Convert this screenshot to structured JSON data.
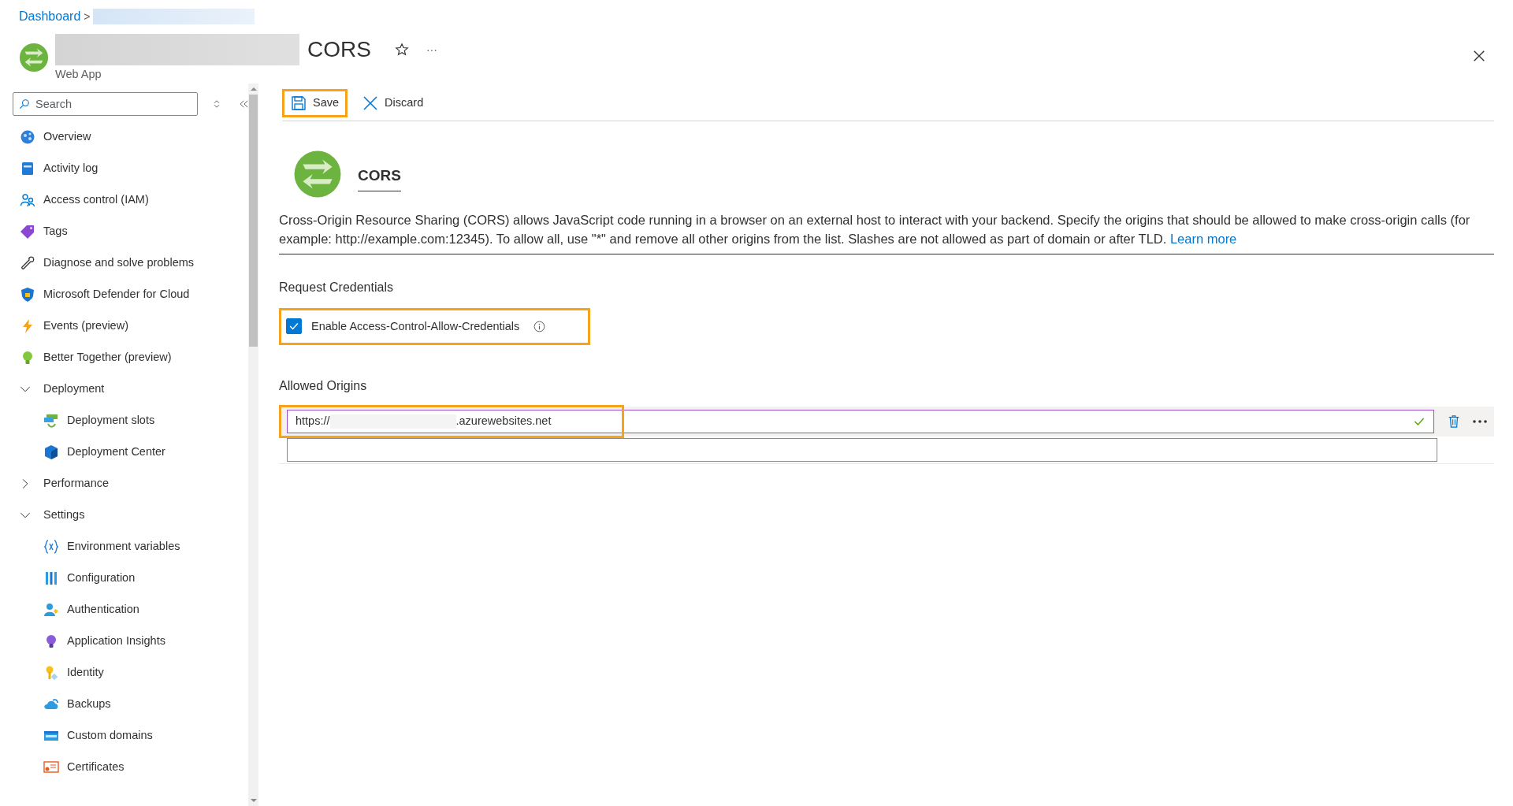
{
  "breadcrumb": {
    "items": [
      {
        "label": "Dashboard"
      }
    ],
    "separator": ">"
  },
  "header": {
    "resource_type": "Web App",
    "title": "CORS",
    "more": "···"
  },
  "sidebar": {
    "search_placeholder": "Search",
    "items": [
      {
        "kind": "item",
        "label": "Overview"
      },
      {
        "kind": "item",
        "label": "Activity log"
      },
      {
        "kind": "item",
        "label": "Access control (IAM)"
      },
      {
        "kind": "item",
        "label": "Tags"
      },
      {
        "kind": "item",
        "label": "Diagnose and solve problems"
      },
      {
        "kind": "item",
        "label": "Microsoft Defender for Cloud"
      },
      {
        "kind": "item",
        "label": "Events (preview)"
      },
      {
        "kind": "item",
        "label": "Better Together (preview)"
      },
      {
        "kind": "group",
        "label": "Deployment",
        "expanded": true,
        "children": [
          {
            "kind": "item",
            "label": "Deployment slots"
          },
          {
            "kind": "item",
            "label": "Deployment Center"
          }
        ]
      },
      {
        "kind": "group",
        "label": "Performance",
        "expanded": false
      },
      {
        "kind": "group",
        "label": "Settings",
        "expanded": true,
        "children": [
          {
            "kind": "item",
            "label": "Environment variables"
          },
          {
            "kind": "item",
            "label": "Configuration"
          },
          {
            "kind": "item",
            "label": "Authentication"
          },
          {
            "kind": "item",
            "label": "Application Insights"
          },
          {
            "kind": "item",
            "label": "Identity"
          },
          {
            "kind": "item",
            "label": "Backups"
          },
          {
            "kind": "item",
            "label": "Custom domains"
          },
          {
            "kind": "item",
            "label": "Certificates"
          }
        ]
      }
    ]
  },
  "toolbar": [
    {
      "kind": "save",
      "label": "Save",
      "highlighted": true
    },
    {
      "kind": "discard",
      "label": "Discard",
      "highlighted": false
    }
  ],
  "content": {
    "heading": "CORS",
    "description": "Cross-Origin Resource Sharing (CORS) allows JavaScript code running in a browser on an external host to interact with your backend. Specify the origins that should be allowed to make cross-origin calls (for example: http://example.com:12345). To allow all, use \"*\" and remove all other origins from the list. Slashes are not allowed as part of domain or after TLD.",
    "learn_more": "Learn more",
    "credentials": {
      "section": "Request Credentials",
      "label": "Enable Access-Control-Allow-Credentials",
      "checked": true,
      "highlighted": true
    },
    "origins": {
      "section": "Allowed Origins",
      "rows": [
        {
          "value_start": "https://",
          "value_end": ".azurewebsites.net",
          "valid": true,
          "highlighted": true
        },
        {
          "value_start": "",
          "value_end": "",
          "valid": false,
          "highlighted": false
        }
      ]
    }
  }
}
